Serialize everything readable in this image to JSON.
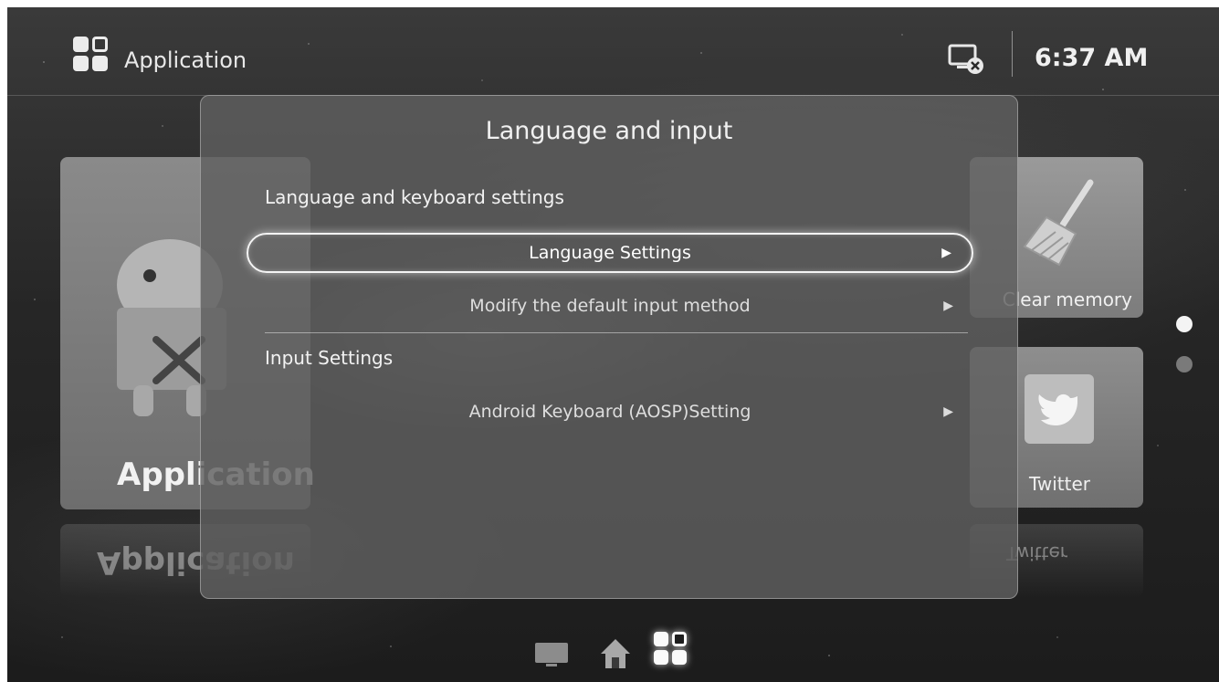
{
  "header": {
    "title": "Application",
    "clock": "6:37 AM",
    "icons": {
      "app": "app-grid-icon",
      "network": "no-network-icon"
    }
  },
  "background_tiles": {
    "application_label": "Application",
    "clear_memory_label": "Clear memory",
    "twitter_label": "Twitter",
    "twitter_reflection_label": "Twitter",
    "application_reflection_label": "Application"
  },
  "dialog": {
    "title": "Language and input",
    "section_language_keyboard": "Language and keyboard settings",
    "options": [
      {
        "label": "Language Settings",
        "selected": true
      },
      {
        "label": "Modify the default input method",
        "selected": false
      }
    ],
    "section_input": "Input Settings",
    "input_options": [
      {
        "label": "Android Keyboard (AOSP)Setting"
      }
    ]
  },
  "bottom_nav": {
    "icons": [
      "tv-icon",
      "home-icon",
      "apps-grid-icon"
    ],
    "active": "apps-grid-icon"
  },
  "colors": {
    "dialog_bg": "#5f5f5f",
    "selected_border": "#f4f4f4",
    "text": "#f0f0f0"
  }
}
